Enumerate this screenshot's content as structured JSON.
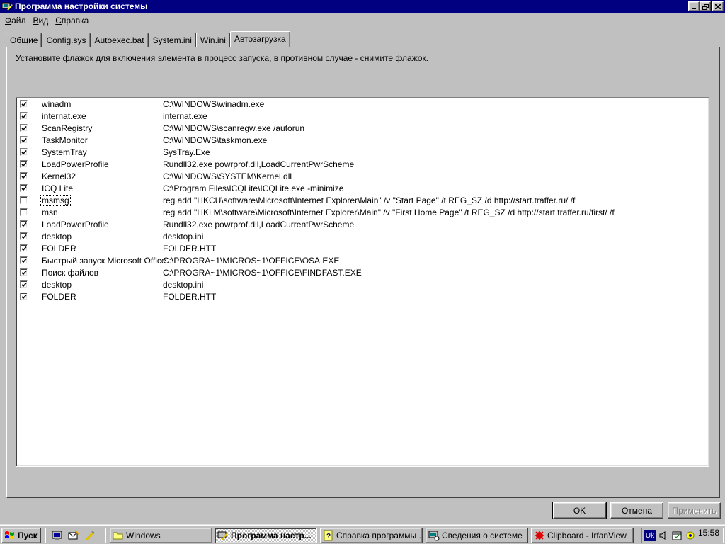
{
  "window": {
    "title": "Программа настройки системы"
  },
  "menu": [
    {
      "ul": "Ф",
      "rest": "айл"
    },
    {
      "ul": "В",
      "rest": "ид"
    },
    {
      "ul": "С",
      "rest": "правка"
    }
  ],
  "tabs": [
    "Общие",
    "Config.sys",
    "Autoexec.bat",
    "System.ini",
    "Win.ini",
    "Автозагрузка"
  ],
  "active_tab": "Автозагрузка",
  "instruction": "Установите флажок для включения элемента в процесс запуска, в противном случае - снимите флажок.",
  "startup_items": [
    {
      "name": "winadm",
      "path": "C:\\WINDOWS\\winadm.exe",
      "checked": true
    },
    {
      "name": "internat.exe",
      "path": "internat.exe",
      "checked": true
    },
    {
      "name": "ScanRegistry",
      "path": "C:\\WINDOWS\\scanregw.exe /autorun",
      "checked": true
    },
    {
      "name": "TaskMonitor",
      "path": "C:\\WINDOWS\\taskmon.exe",
      "checked": true
    },
    {
      "name": "SystemTray",
      "path": "SysTray.Exe",
      "checked": true
    },
    {
      "name": "LoadPowerProfile",
      "path": "Rundll32.exe powrprof.dll,LoadCurrentPwrScheme",
      "checked": true
    },
    {
      "name": "Kernel32",
      "path": "C:\\WINDOWS\\SYSTEM\\Kernel.dll",
      "checked": true
    },
    {
      "name": "ICQ Lite",
      "path": "C:\\Program Files\\ICQLite\\ICQLite.exe -minimize",
      "checked": true
    },
    {
      "name": "msmsg",
      "path": "reg add \"HKCU\\software\\Microsoft\\Internet Explorer\\Main\" /v \"Start Page\" /t REG_SZ /d http://start.traffer.ru/ /f",
      "checked": false,
      "focused": true
    },
    {
      "name": "msn",
      "path": "reg add \"HKLM\\software\\Microsoft\\Internet Explorer\\Main\" /v \"First Home Page\" /t REG_SZ /d http://start.traffer.ru/first/ /f",
      "checked": false
    },
    {
      "name": "LoadPowerProfile",
      "path": "Rundll32.exe powrprof.dll,LoadCurrentPwrScheme",
      "checked": true
    },
    {
      "name": "desktop",
      "path": "desktop.ini",
      "checked": true
    },
    {
      "name": "FOLDER",
      "path": "FOLDER.HTT",
      "checked": true
    },
    {
      "name": "Быстрый запуск Microsoft Office",
      "path": "C:\\PROGRA~1\\MICROS~1\\OFFICE\\OSA.EXE",
      "checked": true
    },
    {
      "name": "Поиск файлов",
      "path": "C:\\PROGRA~1\\MICROS~1\\OFFICE\\FINDFAST.EXE",
      "checked": true
    },
    {
      "name": "desktop",
      "path": "desktop.ini",
      "checked": true
    },
    {
      "name": "FOLDER",
      "path": "FOLDER.HTT",
      "checked": true
    }
  ],
  "buttons": {
    "ok": "OK",
    "cancel": "Отмена",
    "apply": "Применить"
  },
  "taskbar": {
    "start": "Пуск",
    "tasks": [
      {
        "label": "Windows",
        "icon": "folder-icon"
      },
      {
        "label": "Программа настр...",
        "icon": "system-config-icon",
        "active": true
      },
      {
        "label": "Справка программы ...",
        "icon": "help-icon"
      },
      {
        "label": "Сведения о системе",
        "icon": "system-info-icon"
      },
      {
        "label": "Clipboard - IrfanView",
        "icon": "irfanview-icon"
      }
    ],
    "tray_lang": "Uk",
    "clock": "15:58"
  }
}
